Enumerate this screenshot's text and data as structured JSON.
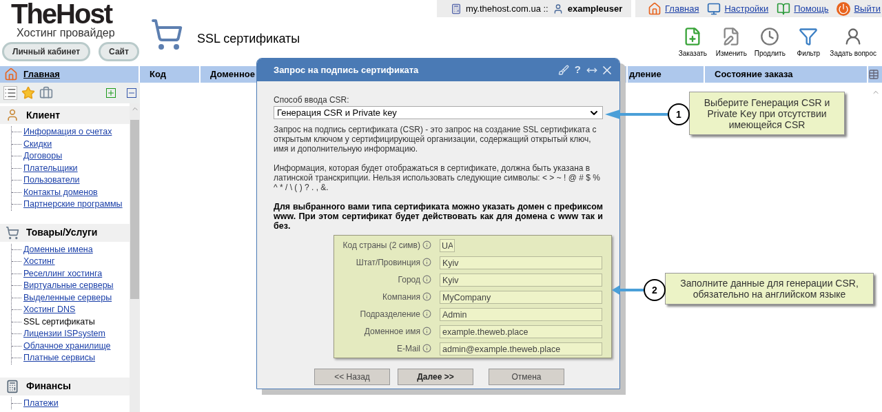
{
  "header": {
    "logo": "TheHost",
    "tagline": "Хостинг провайдер",
    "buttons": [
      "Личный кабинет",
      "Сайт"
    ],
    "page_title": "SSL сертификаты"
  },
  "topbar": {
    "host": "my.thehost.com.ua ::",
    "user": "exampleuser",
    "links": [
      "Главная",
      "Настройки",
      "Помощь",
      "Выйти"
    ]
  },
  "toolbar": [
    "Заказать",
    "Изменить",
    "Продлить",
    "Фильтр",
    "Задать вопрос"
  ],
  "sidebar": {
    "home": "Главная",
    "groups": [
      {
        "title": "Клиент",
        "items": [
          {
            "label": "Информация о счетах",
            "selected": false
          },
          {
            "label": "Скидки",
            "selected": false
          },
          {
            "label": "Договоры",
            "selected": false
          },
          {
            "label": "Плательщики",
            "selected": false
          },
          {
            "label": "Пользователи",
            "selected": false
          },
          {
            "label": "Контакты доменов",
            "selected": false
          },
          {
            "label": "Партнерские программы",
            "selected": false
          }
        ]
      },
      {
        "title": "Товары/Услуги",
        "items": [
          {
            "label": "Доменные имена",
            "selected": false
          },
          {
            "label": "Хостинг",
            "selected": false
          },
          {
            "label": "Реселлинг хостинга",
            "selected": false
          },
          {
            "label": "Виртуальные серверы",
            "selected": false
          },
          {
            "label": "Выделенные серверы",
            "selected": false
          },
          {
            "label": "Хостинг DNS",
            "selected": false
          },
          {
            "label": "SSL сертификаты",
            "selected": true
          },
          {
            "label": "Лицензии ISPsystem",
            "selected": false
          },
          {
            "label": "Облачное хранилище",
            "selected": false
          },
          {
            "label": "Платные сервисы",
            "selected": false
          }
        ]
      },
      {
        "title": "Финансы",
        "items": [
          {
            "label": "Платежи",
            "selected": false
          }
        ]
      }
    ]
  },
  "table": {
    "columns": [
      "Код",
      "Доменное",
      "дление",
      "Состояние заказа"
    ]
  },
  "dialog": {
    "title": "Запрос на подпись сертификата",
    "help_glyph": "?",
    "csr_label": "Способ ввода CSR:",
    "csr_value": "Генерация CSR и Private key",
    "paragraphs": [
      "Запрос на подпись сертификата (CSR) - это запрос на создание SSL сертификата с открытым ключом у сертифицирующей организации, содержащий открытый ключ, имя и дополнительную информацию.",
      "Информация, которая будет отображаться в сертификате, должна быть указана в латинской транскрипции. Нельзя использовать следующие символы: < > ~ ! @ # $ % ^ * / \\ ( ) ? . , &."
    ],
    "note": "Для выбранного вами типа сертификата можно указать домен с префиксом www. При этом сертификат будет действовать как для домена с www так и без.",
    "fields": [
      {
        "label": "Код страны (2 симв)",
        "value": "UA",
        "kind": "short"
      },
      {
        "label": "Штат/Провинция",
        "value": "Kyiv",
        "kind": "full"
      },
      {
        "label": "Город",
        "value": "Kyiv",
        "kind": "full"
      },
      {
        "label": "Компания",
        "value": "MyCompany",
        "kind": "full"
      },
      {
        "label": "Подразделение",
        "value": "Admin",
        "kind": "full"
      },
      {
        "label": "Доменное имя",
        "value": "example.theweb.place",
        "kind": "full"
      },
      {
        "label": "E-Mail",
        "value": "admin@example.theweb.place",
        "kind": "full"
      }
    ],
    "buttons": [
      {
        "label": "<< Назад",
        "primary": false
      },
      {
        "label": "Далее >>",
        "primary": true
      },
      {
        "label": "Отмена",
        "primary": false
      }
    ]
  },
  "callouts": [
    {
      "number": "1",
      "text": "Выберите Генерация CSR и Private Key при отсутствии имеющейся CSR"
    },
    {
      "number": "2",
      "text": "Заполните данные для генерации CSR, обязательно на английском языке"
    }
  ]
}
